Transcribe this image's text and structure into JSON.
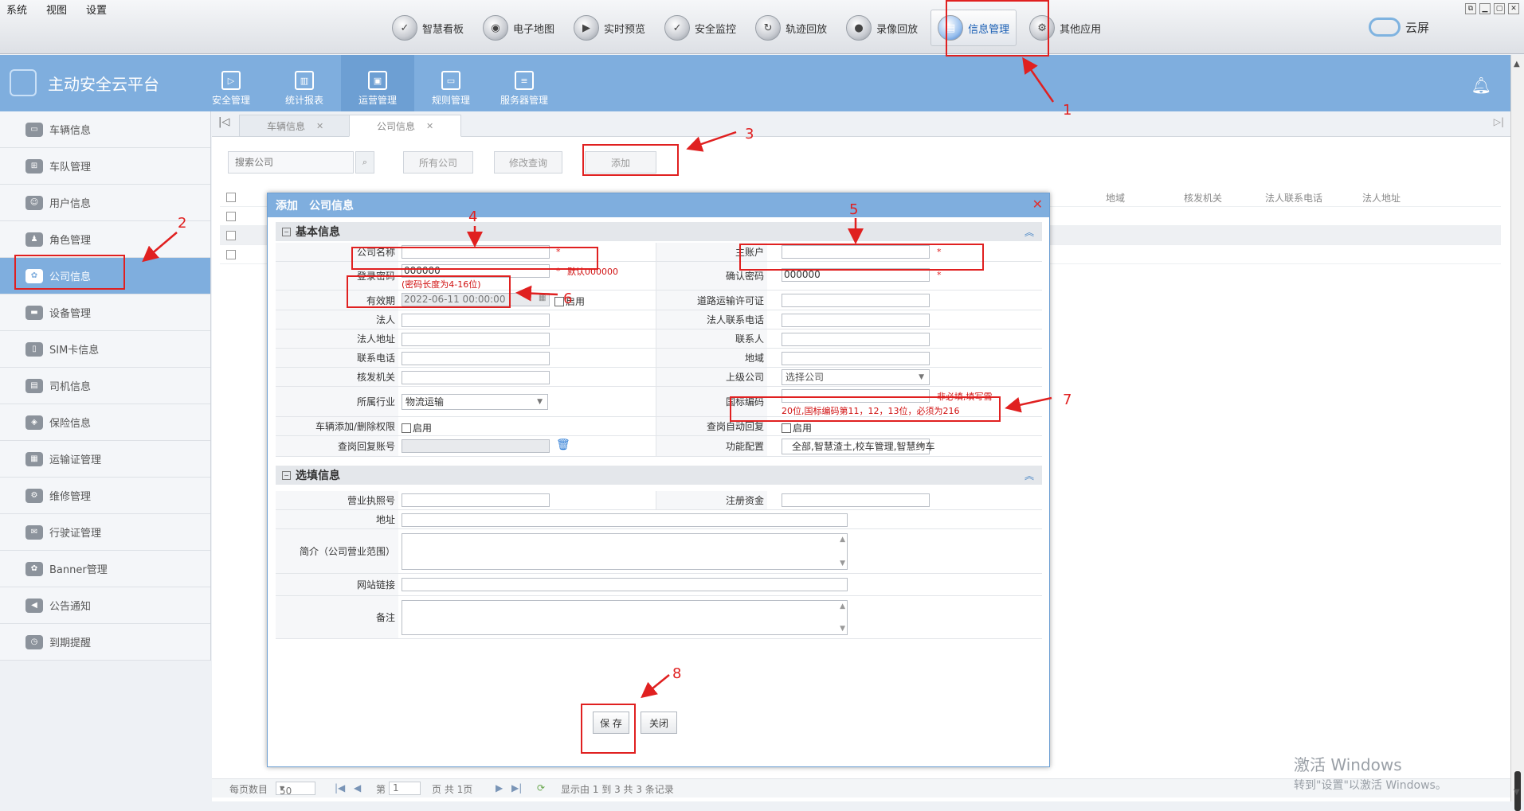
{
  "sysmenu": [
    "系统",
    "视图",
    "设置"
  ],
  "topnav": [
    {
      "label": "智慧看板",
      "icon": "dashboard-icon",
      "glyph": "✓"
    },
    {
      "label": "电子地图",
      "icon": "map-icon",
      "glyph": "◉"
    },
    {
      "label": "实时预览",
      "icon": "preview-icon",
      "glyph": "▶"
    },
    {
      "label": "安全监控",
      "icon": "shield-icon",
      "glyph": "✓"
    },
    {
      "label": "轨迹回放",
      "icon": "track-icon",
      "glyph": "↻"
    },
    {
      "label": "录像回放",
      "icon": "video-icon",
      "glyph": "●"
    },
    {
      "label": "信息管理",
      "icon": "info-management-icon",
      "glyph": "▤"
    },
    {
      "label": "其他应用",
      "icon": "apps-icon",
      "glyph": "⚙"
    }
  ],
  "topnav_active_index": 6,
  "cloud_label": "云屏",
  "brand": "主动安全云平台",
  "modules": [
    {
      "label": "安全管理",
      "glyph": "▷"
    },
    {
      "label": "统计报表",
      "glyph": "▥"
    },
    {
      "label": "运营管理",
      "glyph": "▣"
    },
    {
      "label": "规则管理",
      "glyph": "▭"
    },
    {
      "label": "服务器管理",
      "glyph": "≡"
    }
  ],
  "modules_active_index": 2,
  "sidebar": [
    {
      "label": "车辆信息",
      "icon": "vehicle-icon",
      "glyph": "▭"
    },
    {
      "label": "车队管理",
      "icon": "fleet-icon",
      "glyph": "⊞"
    },
    {
      "label": "用户信息",
      "icon": "user-icon",
      "glyph": "☺"
    },
    {
      "label": "角色管理",
      "icon": "role-icon",
      "glyph": "♟"
    },
    {
      "label": "公司信息",
      "icon": "company-icon",
      "glyph": "✿"
    },
    {
      "label": "设备管理",
      "icon": "device-icon",
      "glyph": "▬"
    },
    {
      "label": "SIM卡信息",
      "icon": "sim-icon",
      "glyph": "▯"
    },
    {
      "label": "司机信息",
      "icon": "driver-icon",
      "glyph": "▤"
    },
    {
      "label": "保险信息",
      "icon": "insurance-icon",
      "glyph": "◈"
    },
    {
      "label": "运输证管理",
      "icon": "transport-cert-icon",
      "glyph": "▦"
    },
    {
      "label": "维修管理",
      "icon": "repair-icon",
      "glyph": "⚙"
    },
    {
      "label": "行驶证管理",
      "icon": "license-icon",
      "glyph": "✉"
    },
    {
      "label": "Banner管理",
      "icon": "banner-icon",
      "glyph": "✿"
    },
    {
      "label": "公告通知",
      "icon": "notice-icon",
      "glyph": "◀"
    },
    {
      "label": "到期提醒",
      "icon": "expiry-icon",
      "glyph": "◷"
    }
  ],
  "sidebar_active_index": 4,
  "tabs": [
    {
      "label": "车辆信息"
    },
    {
      "label": "公司信息"
    }
  ],
  "tabs_active_index": 1,
  "toolbar": {
    "search_placeholder": "搜索公司",
    "all_companies": "所有公司",
    "modify_query": "修改查询",
    "add": "添加"
  },
  "grid_headers": [
    "地域",
    "核发机关",
    "法人联系电话",
    "法人地址"
  ],
  "grid_rows": 3,
  "pager": {
    "per_page_label": "每页数目",
    "per_page": "50",
    "page_prefix": "第",
    "page": "1",
    "page_suffix": "页 共 1页",
    "summary": "显示由 1 到 3 共 3 条记录"
  },
  "watermark": {
    "line1": "激活 Windows",
    "line2": "转到\"设置\"以激活 Windows。"
  },
  "modal": {
    "title_action": "添加",
    "title": "公司信息",
    "section_basic": "基本信息",
    "section_optional": "选填信息",
    "fields": {
      "company_name": "公司名称",
      "main_account": "主账户",
      "login_password": "登录密码",
      "login_password_value": "000000",
      "password_hint": "(密码长度为4-16位)",
      "password_default": "默认000000",
      "confirm_password": "确认密码",
      "confirm_password_value": "000000",
      "validity": "有效期",
      "validity_value": "2022-06-11 00:00:00",
      "enable": "启用",
      "road_permit": "道路运输许可证",
      "legal_person": "法人",
      "legal_phone": "法人联系电话",
      "legal_address": "法人地址",
      "contact": "联系人",
      "contact_phone": "联系电话",
      "region": "地域",
      "issuing_authority": "核发机关",
      "parent_company": "上级公司",
      "parent_company_value": "选择公司",
      "industry": "所属行业",
      "industry_value": "物流运输",
      "gb_code": "国标编码",
      "gb_hint1": "非必填,填写需",
      "gb_hint2": "20位,国标编码第11，12，13位，必须为216",
      "vehicle_permission": "车辆添加/删除权限",
      "auto_reply": "查岗自动回复",
      "reply_account": "查岗回复账号",
      "function_config": "功能配置",
      "function_config_value": "全部,智慧渣土,校车管理,智慧约车",
      "business_license": "营业执照号",
      "registered_capital": "注册资金",
      "address": "地址",
      "intro": "简介（公司营业范围）",
      "website": "网站链接",
      "remark": "备注"
    },
    "save": "保 存",
    "close": "关闭"
  },
  "annotations": [
    "1",
    "2",
    "3",
    "4",
    "5",
    "6",
    "7",
    "8"
  ],
  "colors": {
    "header_blue": "#7faede",
    "annotation_red": "#e02020"
  }
}
